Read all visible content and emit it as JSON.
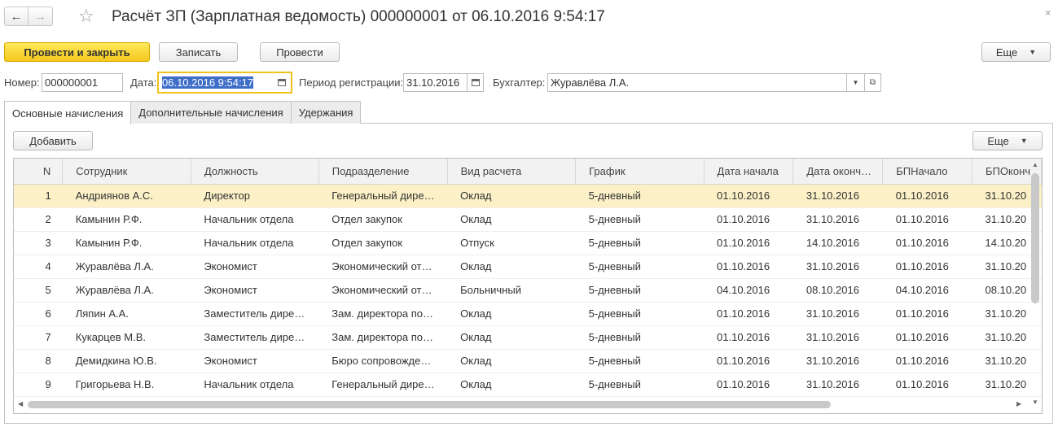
{
  "header": {
    "title": "Расчёт ЗП (Зарплатная ведомость) 000000001 от 06.10.2016 9:54:17",
    "back_icon": "←",
    "forward_icon": "→",
    "star_icon": "☆",
    "close_icon": "×"
  },
  "toolbar": {
    "post_close_label": "Провести и закрыть",
    "save_label": "Записать",
    "post_label": "Провести",
    "more_label": "Еще"
  },
  "form": {
    "number_label": "Номер:",
    "number_value": "000000001",
    "date_label": "Дата:",
    "date_value": "06.10.2016  9:54:17",
    "period_label": "Период регистрации:",
    "period_value": "31.10.2016",
    "accountant_label": "Бухгалтер:",
    "accountant_value": "Журавлёва Л.А."
  },
  "tabs": [
    {
      "label": "Основные начисления",
      "active": true
    },
    {
      "label": "Дополнительные начисления",
      "active": false
    },
    {
      "label": "Удержания",
      "active": false
    }
  ],
  "table_toolbar": {
    "add_label": "Добавить",
    "more_label": "Еще"
  },
  "table": {
    "columns": [
      "N",
      "Сотрудник",
      "Должность",
      "Подразделение",
      "Вид расчета",
      "График",
      "Дата начала",
      "Дата оконч…",
      "БПНачало",
      "БПОконч"
    ],
    "rows": [
      [
        "1",
        "Андриянов А.С.",
        "Директор",
        "Генеральный дире…",
        "Оклад",
        "5-дневный",
        "01.10.2016",
        "31.10.2016",
        "01.10.2016",
        "31.10.20"
      ],
      [
        "2",
        "Камынин Р.Ф.",
        "Начальник отдела",
        "Отдел закупок",
        "Оклад",
        "5-дневный",
        "01.10.2016",
        "31.10.2016",
        "01.10.2016",
        "31.10.20"
      ],
      [
        "3",
        "Камынин Р.Ф.",
        "Начальник отдела",
        "Отдел закупок",
        "Отпуск",
        "5-дневный",
        "01.10.2016",
        "14.10.2016",
        "01.10.2016",
        "14.10.20"
      ],
      [
        "4",
        "Журавлёва Л.А.",
        "Экономист",
        "Экономический от…",
        "Оклад",
        "5-дневный",
        "01.10.2016",
        "31.10.2016",
        "01.10.2016",
        "31.10.20"
      ],
      [
        "5",
        "Журавлёва Л.А.",
        "Экономист",
        "Экономический от…",
        "Больничный",
        "5-дневный",
        "04.10.2016",
        "08.10.2016",
        "04.10.2016",
        "08.10.20"
      ],
      [
        "6",
        "Ляпин А.А.",
        "Заместитель дире…",
        "Зам. директора по…",
        "Оклад",
        "5-дневный",
        "01.10.2016",
        "31.10.2016",
        "01.10.2016",
        "31.10.20"
      ],
      [
        "7",
        "Кукарцев М.В.",
        "Заместитель дире…",
        "Зам. директора по…",
        "Оклад",
        "5-дневный",
        "01.10.2016",
        "31.10.2016",
        "01.10.2016",
        "31.10.20"
      ],
      [
        "8",
        "Демидкина Ю.В.",
        "Экономист",
        "Бюро сопровожде…",
        "Оклад",
        "5-дневный",
        "01.10.2016",
        "31.10.2016",
        "01.10.2016",
        "31.10.20"
      ],
      [
        "9",
        "Григорьева Н.В.",
        "Начальник отдела",
        "Генеральный дире…",
        "Оклад",
        "5-дневный",
        "01.10.2016",
        "31.10.2016",
        "01.10.2016",
        "31.10.20"
      ]
    ]
  },
  "colors": {
    "primary_button": "#f4c81d",
    "selected_row": "#fbf0c6",
    "focus_border": "#f0c21c",
    "selection": "#3e6ec8"
  }
}
